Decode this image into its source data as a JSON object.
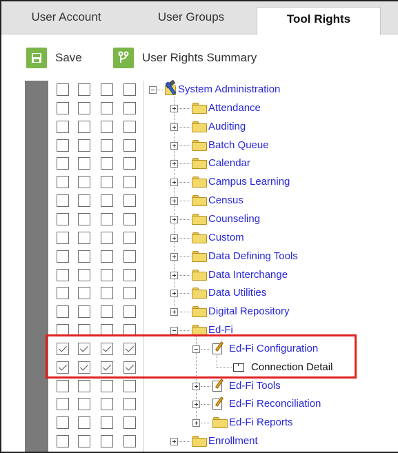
{
  "tabs": [
    {
      "label": "User Account",
      "active": false
    },
    {
      "label": "User Groups",
      "active": false
    },
    {
      "label": "Tool Rights",
      "active": true
    }
  ],
  "toolbar": {
    "save_label": "Save",
    "save_icon": "save-icon",
    "summary_label": "User Rights Summary",
    "summary_icon": "branch-icon"
  },
  "colors": {
    "accent_green": "#7ab648",
    "link_blue": "#2626d9",
    "highlight_red": "#e02020",
    "rail_gray": "#7a7a7a"
  },
  "permission_rows": [
    {
      "checked": [
        false,
        false,
        false,
        false
      ]
    },
    {
      "checked": [
        false,
        false,
        false,
        false
      ]
    },
    {
      "checked": [
        false,
        false,
        false,
        false
      ]
    },
    {
      "checked": [
        false,
        false,
        false,
        false
      ]
    },
    {
      "checked": [
        false,
        false,
        false,
        false
      ]
    },
    {
      "checked": [
        false,
        false,
        false,
        false
      ]
    },
    {
      "checked": [
        false,
        false,
        false,
        false
      ]
    },
    {
      "checked": [
        false,
        false,
        false,
        false
      ]
    },
    {
      "checked": [
        false,
        false,
        false,
        false
      ]
    },
    {
      "checked": [
        false,
        false,
        false,
        false
      ]
    },
    {
      "checked": [
        false,
        false,
        false,
        false
      ]
    },
    {
      "checked": [
        false,
        false,
        false,
        false
      ]
    },
    {
      "checked": [
        false,
        false,
        false,
        false
      ]
    },
    {
      "checked": [
        false,
        false,
        false,
        false
      ]
    },
    {
      "checked": [
        true,
        true,
        true,
        true
      ]
    },
    {
      "checked": [
        true,
        true,
        true,
        true
      ]
    },
    {
      "checked": [
        false,
        false,
        false,
        false
      ]
    },
    {
      "checked": [
        false,
        false,
        false,
        false
      ]
    },
    {
      "checked": [
        false,
        false,
        false,
        false
      ]
    },
    {
      "checked": [
        false,
        false,
        false,
        false
      ]
    }
  ],
  "tree": {
    "root": {
      "label": "System Administration",
      "icon": "toolbox-icon",
      "expanded": true
    },
    "level1": [
      {
        "label": "Attendance",
        "icon": "folder-icon",
        "expanded": false
      },
      {
        "label": "Auditing",
        "icon": "folder-icon",
        "expanded": false
      },
      {
        "label": "Batch Queue",
        "icon": "folder-icon",
        "expanded": false
      },
      {
        "label": "Calendar",
        "icon": "folder-icon",
        "expanded": false
      },
      {
        "label": "Campus Learning",
        "icon": "folder-icon",
        "expanded": false
      },
      {
        "label": "Census",
        "icon": "folder-icon",
        "expanded": false
      },
      {
        "label": "Counseling",
        "icon": "folder-icon",
        "expanded": false
      },
      {
        "label": "Custom",
        "icon": "folder-icon",
        "expanded": false
      },
      {
        "label": "Data Defining Tools",
        "icon": "folder-icon",
        "expanded": false
      },
      {
        "label": "Data Interchange",
        "icon": "folder-icon",
        "expanded": false
      },
      {
        "label": "Data Utilities",
        "icon": "folder-icon",
        "expanded": false
      },
      {
        "label": "Digital Repository",
        "icon": "folder-icon",
        "expanded": false
      },
      {
        "label": "Ed-Fi",
        "icon": "folder-icon",
        "expanded": true
      }
    ],
    "edfi_children": [
      {
        "label": "Ed-Fi Configuration",
        "icon": "edit-icon",
        "expanded": true
      },
      {
        "label": "Ed-Fi Tools",
        "icon": "edit-icon",
        "expanded": false
      },
      {
        "label": "Ed-Fi Reconciliation",
        "icon": "edit-icon",
        "expanded": false
      },
      {
        "label": "Ed-Fi Reports",
        "icon": "folder-icon",
        "expanded": false
      }
    ],
    "config_children": [
      {
        "label": "Connection Detail",
        "icon": "document-icon"
      }
    ],
    "after_edfi": [
      {
        "label": "Enrollment",
        "icon": "folder-icon",
        "expanded": false
      }
    ]
  }
}
